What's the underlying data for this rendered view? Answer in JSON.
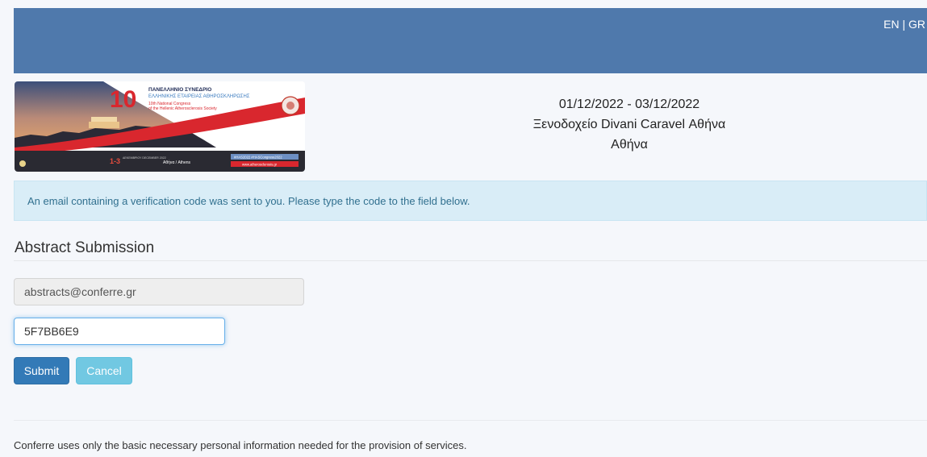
{
  "header": {
    "lang_en": "EN",
    "lang_sep": "|",
    "lang_gr": "GR"
  },
  "banner": {
    "big_number": "10",
    "line1": "ΠΑΝΕΛΛΗΝΙΟ ΣΥΝΕΔΡΙΟ",
    "line2": "ΕΛΛΗΝΙΚΗΣ ΕΤΑΙΡΕΙΑΣ ΑΘΗΡΟΣΚΛΗΡΩΣΗΣ",
    "line3": "10th National Congress",
    "line4": "of the Hellenic Atherosclerosis Society",
    "dates": "1-3",
    "month": "ΔΕΚΕΜΒΡΙΟΥ DECEMBER 2022",
    "city": "Αθήνα / Athens",
    "hashtag": "#HAS2022 #HASCongress2022",
    "website": "www.atherosclerosis.gr"
  },
  "event": {
    "dates": "01/12/2022 - 03/12/2022",
    "venue": "Ξενοδοχείο Divani Caravel Αθήνα",
    "city": "Αθήνα"
  },
  "alert": {
    "message": "An email containing a verification code was sent to you. Please type the code to the field below."
  },
  "form": {
    "title": "Abstract Submission",
    "email_value": "abstracts@conferre.gr",
    "code_value": "5F7BB6E9",
    "submit_label": "Submit",
    "cancel_label": "Cancel"
  },
  "footer": {
    "text": "Conferre uses only the basic necessary personal information needed for the provision of services."
  }
}
